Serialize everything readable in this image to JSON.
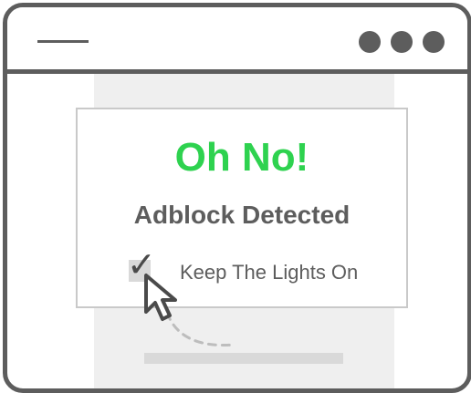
{
  "window": {
    "menu_icon": "hamburger-line-icon",
    "controls": [
      "dot-icon",
      "dot-icon",
      "dot-icon"
    ]
  },
  "modal": {
    "heading": "Oh No!",
    "subheading": "Adblock Detected",
    "checkbox_label": "Keep The Lights On",
    "checkbox_checked": true,
    "heading_color": "#2ed24f",
    "text_color": "#5d5d5d"
  },
  "cursor": {
    "icon": "mouse-pointer-icon"
  }
}
